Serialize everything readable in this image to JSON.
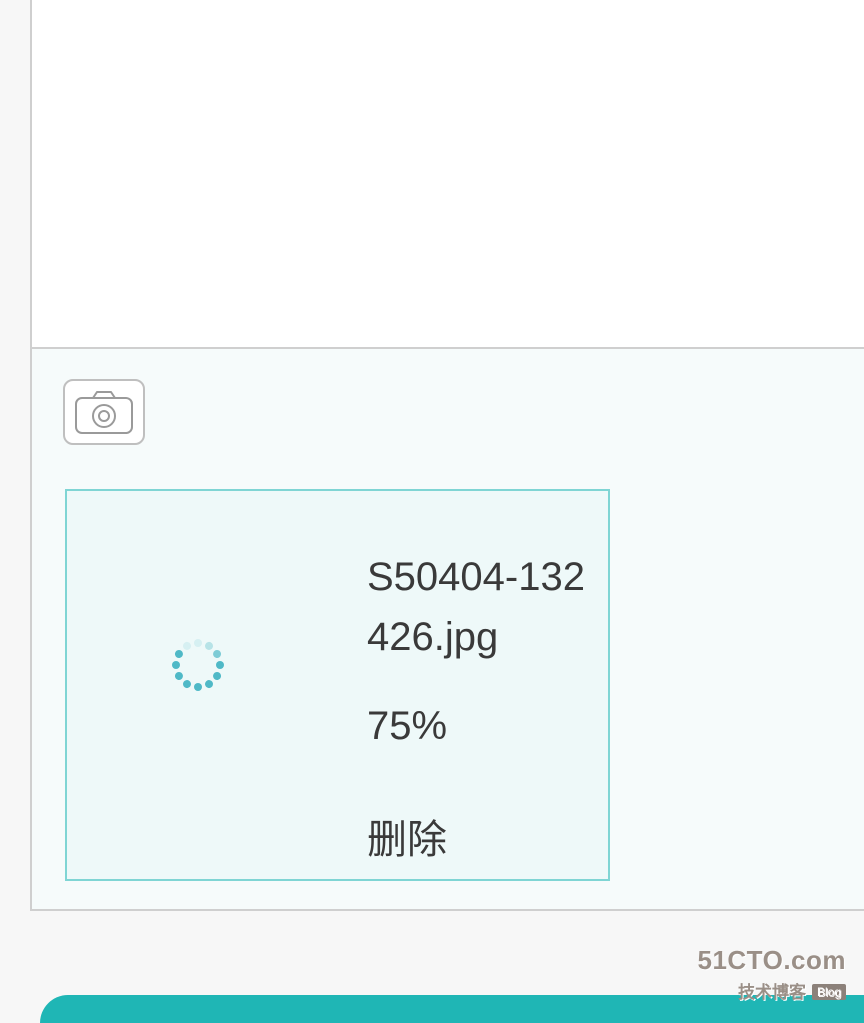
{
  "upload": {
    "file": {
      "name": "S50404-132426.jpg",
      "progress_text": "75%",
      "delete_label": "删除"
    }
  },
  "watermark": {
    "line1": "51CTO.com",
    "line2": "技术博客",
    "badge": "Blog"
  },
  "colors": {
    "accent": "#1fb6b5",
    "card_border": "#7fd5d4",
    "card_bg": "#eef9f9"
  }
}
